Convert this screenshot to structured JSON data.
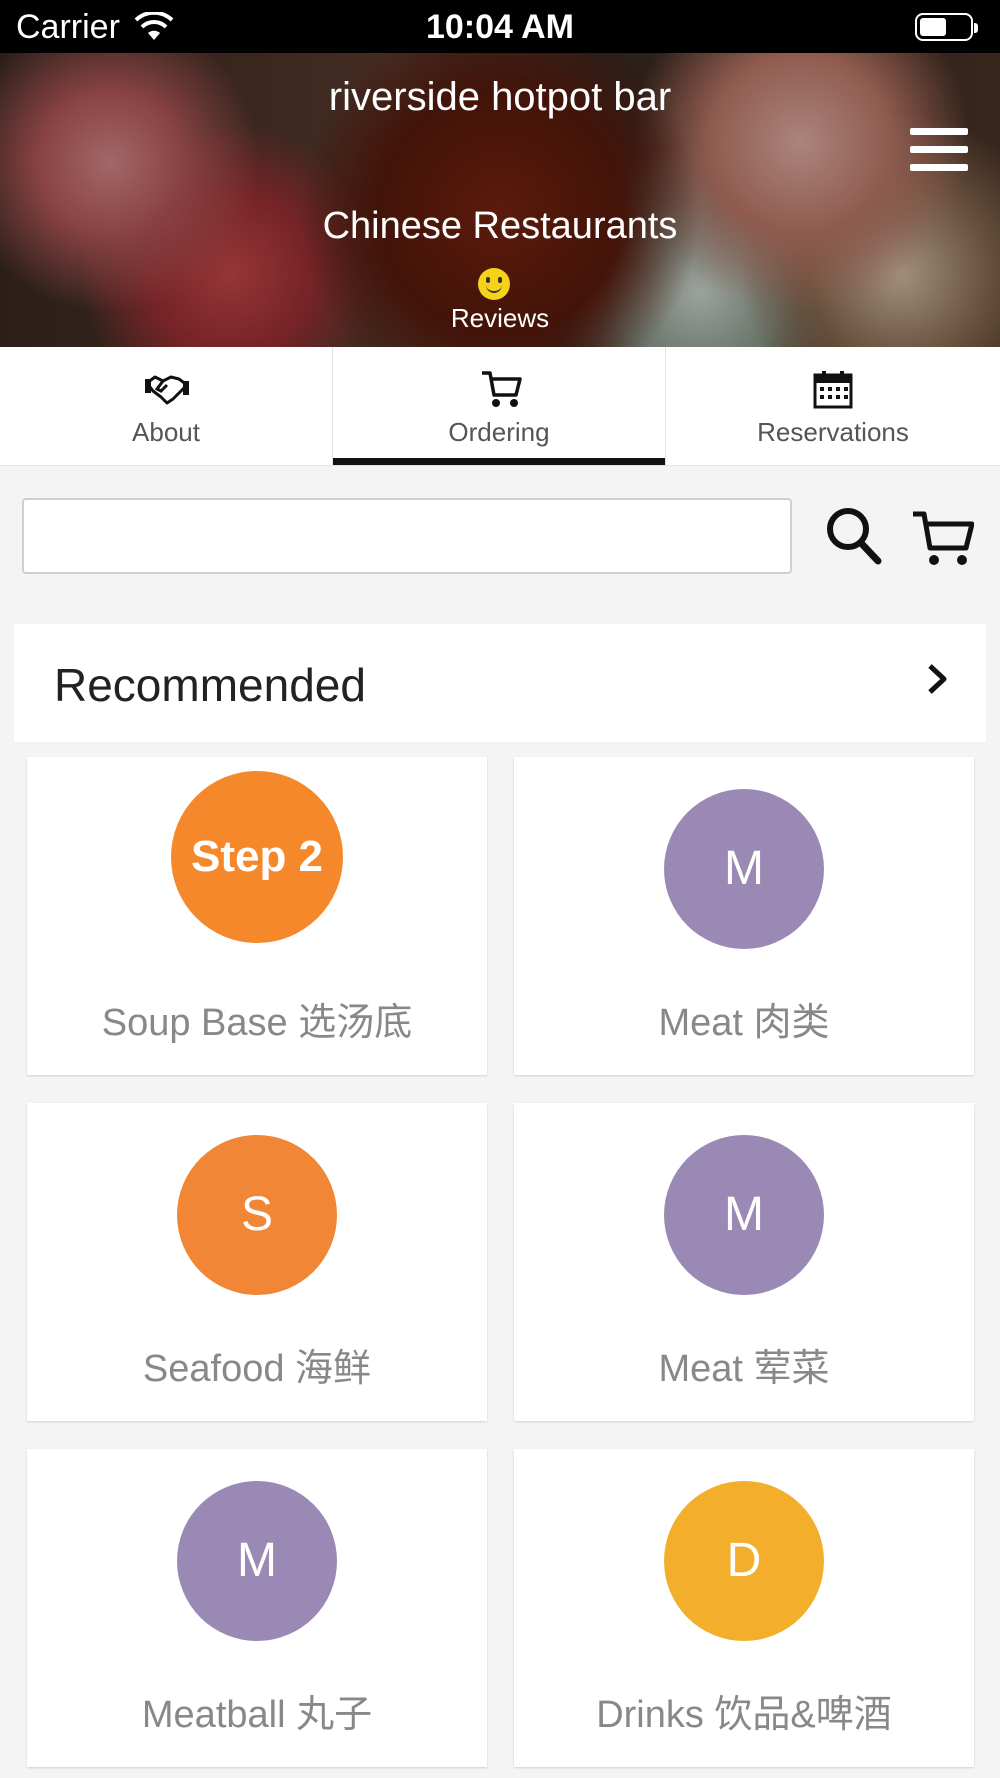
{
  "status_bar": {
    "carrier": "Carrier",
    "time": "10:04 AM"
  },
  "hero": {
    "title": "riverside hotpot bar",
    "subtitle": "Chinese Restaurants",
    "reviews_label": "Reviews"
  },
  "tabs": [
    {
      "label": "About",
      "icon": "handshake-icon",
      "active": false
    },
    {
      "label": "Ordering",
      "icon": "cart-icon",
      "active": true
    },
    {
      "label": "Reservations",
      "icon": "calendar-icon",
      "active": false
    }
  ],
  "search": {
    "value": "",
    "placeholder": ""
  },
  "recommended": {
    "title": "Recommended"
  },
  "categories": [
    {
      "name": "Soup Base 选汤底",
      "badge": "Step 2",
      "color": "#f5882a"
    },
    {
      "name": "Meat 肉类",
      "badge": "M",
      "color": "#9b89b5"
    },
    {
      "name": "Seafood 海鲜",
      "badge": "S",
      "color": "#f08636"
    },
    {
      "name": "Meat 荤菜",
      "badge": "M",
      "color": "#9b89b5"
    },
    {
      "name": "Meatball 丸子",
      "badge": "M",
      "color": "#9b89b5"
    },
    {
      "name": "Drinks 饮品&啤酒",
      "badge": "D",
      "color": "#f3ae2b"
    }
  ]
}
